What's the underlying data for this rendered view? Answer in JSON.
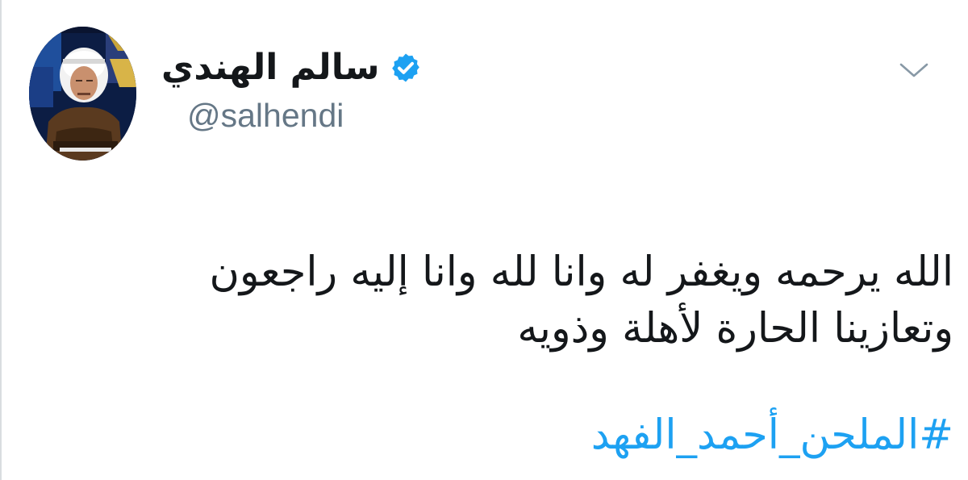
{
  "author": {
    "display_name": "سالم الهندي",
    "handle": "@salhendi",
    "verified": true,
    "avatar_icon": "profile-photo"
  },
  "menu": {
    "icon": "chevron-down-icon"
  },
  "tweet": {
    "lines": [
      "الله يرحمه ويغفر له وانا لله وانا إليه راجعون",
      "وتعازينا الحارة لأهلة وذويه"
    ],
    "hashtag": "#الملحن_أحمد_الفهد"
  },
  "colors": {
    "text": "#14171a",
    "handle": "#657786",
    "link": "#1da1f2",
    "verified": "#1da1f2",
    "chevron": "#8899a6"
  }
}
